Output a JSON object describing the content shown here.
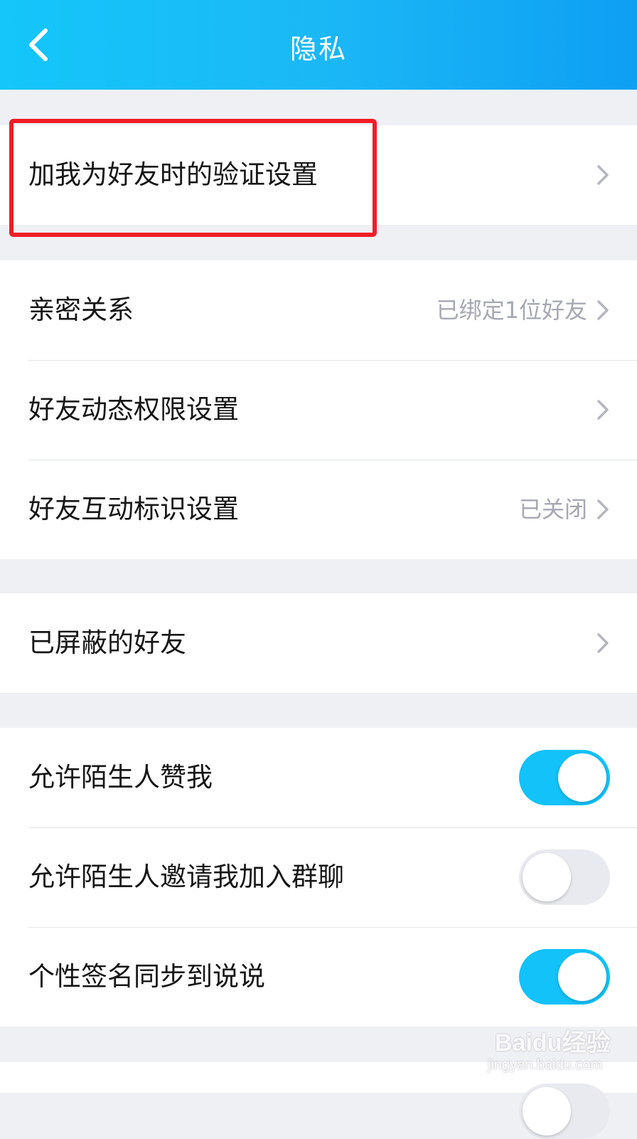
{
  "header": {
    "title": "隐私",
    "back_icon": "chevron-left-icon",
    "gradient_colors": [
      "#14c6fa",
      "#0e9ff3"
    ]
  },
  "group1": {
    "items": [
      {
        "label": "加我为好友时的验证设置",
        "value": ""
      }
    ]
  },
  "group2": {
    "items": [
      {
        "label": "亲密关系",
        "value": "已绑定1位好友"
      },
      {
        "label": "好友动态权限设置",
        "value": ""
      },
      {
        "label": "好友互动标识设置",
        "value": "已关闭"
      }
    ]
  },
  "group3": {
    "items": [
      {
        "label": "已屏蔽的好友",
        "value": ""
      }
    ]
  },
  "group4": {
    "items": [
      {
        "label": "允许陌生人赞我",
        "toggle": "on"
      },
      {
        "label": "允许陌生人邀请我加入群聊",
        "toggle": "off"
      },
      {
        "label": "个性签名同步到说说",
        "toggle": "on"
      }
    ]
  },
  "colors": {
    "toggle_on": "#12c2f9",
    "toggle_off": "#e9eaef",
    "highlight_border": "#f11e26",
    "page_background": "#eff0f4"
  },
  "watermark": {
    "logo": "Baidu经验",
    "url": "jingyan.baidu.com"
  }
}
